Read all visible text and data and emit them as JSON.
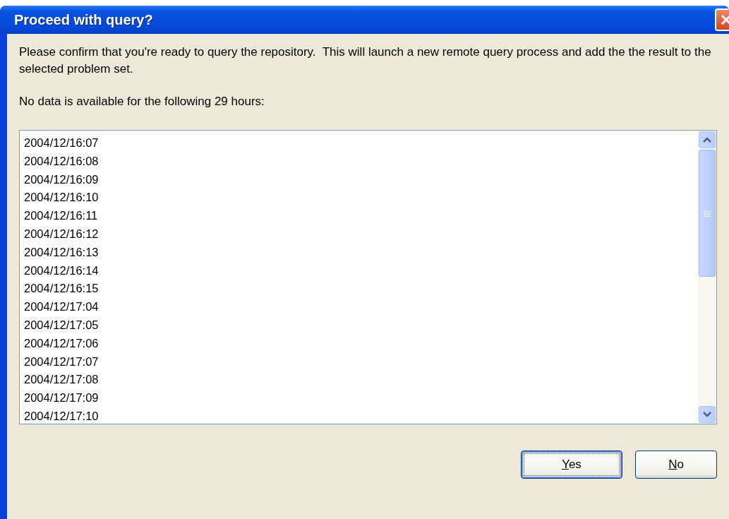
{
  "window": {
    "title": "Proceed with query?"
  },
  "message": "Please confirm that you're ready to query the repository.  This will launch a new remote query process and add the the result to the selected problem set.",
  "list_label": "No data is available for the following 29 hours:",
  "hours": [
    "2004/12/16:07",
    "2004/12/16:08",
    "2004/12/16:09",
    "2004/12/16:10",
    "2004/12/16:11",
    "2004/12/16:12",
    "2004/12/16:13",
    "2004/12/16:14",
    "2004/12/16:15",
    "2004/12/17:04",
    "2004/12/17:05",
    "2004/12/17:06",
    "2004/12/17:07",
    "2004/12/17:08",
    "2004/12/17:09",
    "2004/12/17:10"
  ],
  "buttons": [
    {
      "label": "Yes",
      "selected": true
    },
    {
      "label": "No",
      "selected": false
    }
  ]
}
